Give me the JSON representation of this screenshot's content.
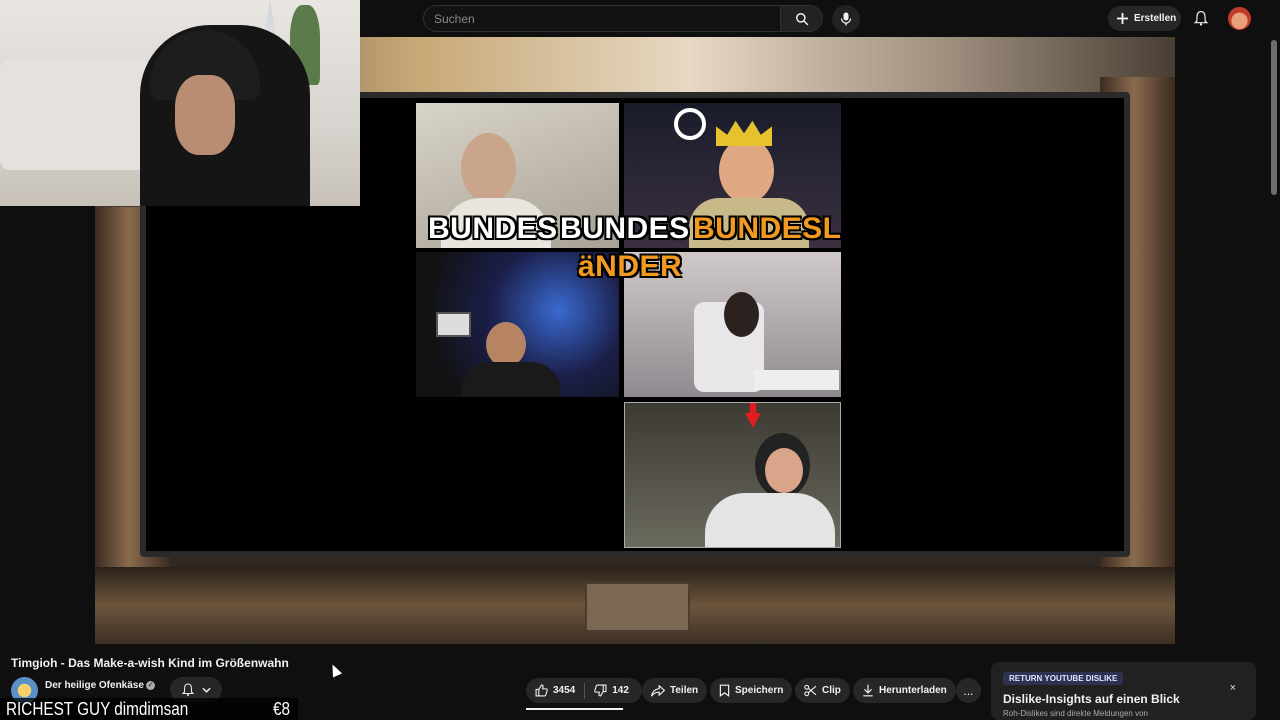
{
  "topbar": {
    "search_placeholder": "Suchen",
    "create_label": "Erstellen",
    "icons": [
      "search-icon",
      "mic-icon",
      "plus-icon",
      "bell-icon"
    ]
  },
  "thumbnail_text": {
    "line1_a": "BUNDES",
    "line1_b": "BUNDES",
    "line1_c": "BUNDESL",
    "line2": "äNDER"
  },
  "video": {
    "title": "Timgioh - Das Make-a-wish Kind im Größenwahn",
    "channel": "Der heilige Ofenkäse"
  },
  "actions": {
    "likes": "3454",
    "dislikes": "142",
    "share": "Teilen",
    "save": "Speichern",
    "clip": "Clip",
    "download": "Herunterladen",
    "more": "..."
  },
  "ryd_card": {
    "badge": "RETURN YOUTUBE DISLIKE",
    "title": "Dislike-Insights auf einen Blick",
    "subtitle": "Roh-Dislikes sind direkte Meldungen von",
    "close": "×"
  },
  "stream_overlay": {
    "name": "RICHEST GUY dimdimsan",
    "amount": "€8"
  },
  "colors": {
    "background": "#0f0f0f",
    "chip": "#272727",
    "accent_orange": "#f29a1f"
  }
}
